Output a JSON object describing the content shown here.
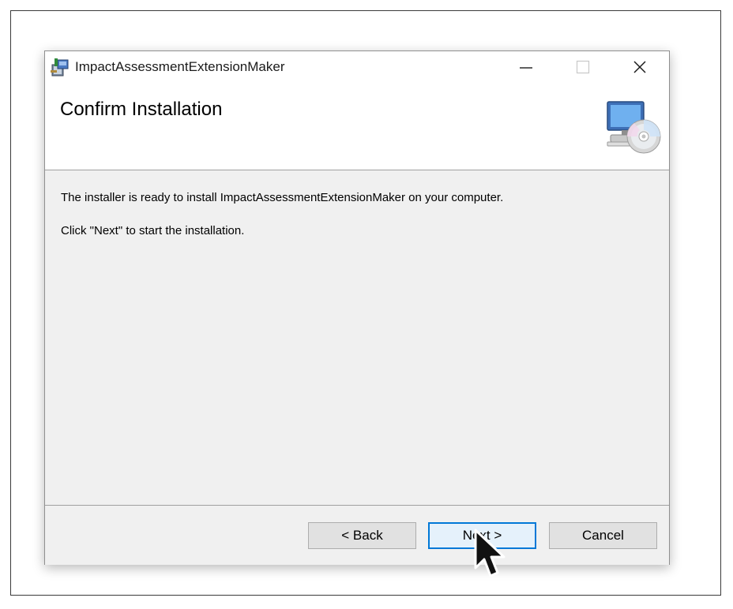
{
  "window": {
    "title": "ImpactAssessmentExtensionMaker",
    "minimize_icon": "minimize-icon",
    "maximize_icon": "maximize-icon",
    "close_icon": "close-icon"
  },
  "header": {
    "title": "Confirm Installation",
    "icon": "computer-cd-icon"
  },
  "body": {
    "message1": "The installer is ready to install ImpactAssessmentExtensionMaker on your computer.",
    "message2": "Click \"Next\" to start the installation."
  },
  "buttons": {
    "back": "< Back",
    "next": "Next >",
    "cancel": "Cancel"
  },
  "colors": {
    "accent": "#0078d7",
    "panel": "#f0f0f0"
  }
}
